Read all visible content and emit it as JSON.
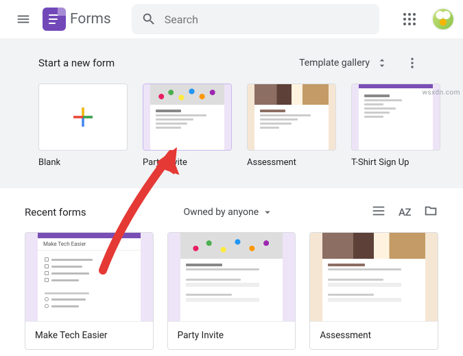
{
  "header": {
    "app_name": "Forms",
    "search_placeholder": "Search"
  },
  "templates": {
    "section_title": "Start a new form",
    "gallery_button": "Template gallery",
    "items": [
      {
        "label": "Blank"
      },
      {
        "label": "Party Invite"
      },
      {
        "label": "Assessment"
      },
      {
        "label": "T-Shirt Sign Up"
      }
    ]
  },
  "recent": {
    "section_title": "Recent forms",
    "owned_label": "Owned by anyone",
    "sort_label": "AZ",
    "items": [
      {
        "label": "Make Tech Easier"
      },
      {
        "label": "Party Invite"
      },
      {
        "label": "Assessment"
      }
    ]
  },
  "watermark": "wsxdn.com"
}
